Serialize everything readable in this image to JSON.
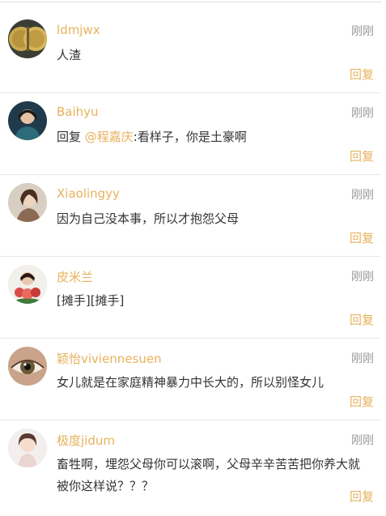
{
  "comments": [
    {
      "username": "ldmjwx",
      "time": "刚刚",
      "content": "人渣",
      "reply_label": "回复",
      "avatar_icon": "coins-avatar"
    },
    {
      "username": "Baihyu",
      "time": "刚刚",
      "content_prefix": "回复 ",
      "mention": "@程嘉庆",
      "content": ":看样子，你是土豪啊",
      "reply_label": "回复",
      "avatar_icon": "person-avatar"
    },
    {
      "username": "Xiaolingyy",
      "time": "刚刚",
      "content": "因为自己没本事，所以才抱怨父母",
      "reply_label": "回复",
      "avatar_icon": "girl-avatar"
    },
    {
      "username": "皮米兰",
      "time": "刚刚",
      "content": "[摊手][摊手]",
      "reply_label": "回复",
      "avatar_icon": "flowers-avatar"
    },
    {
      "username": "颖怡viviennesuen",
      "time": "刚刚",
      "content": "女儿就是在家庭精神暴力中长大的，所以别怪女儿",
      "reply_label": "回复",
      "avatar_icon": "eye-avatar"
    },
    {
      "username": "极度jidum",
      "time": "刚刚",
      "content": "畜牲啊，埋怨父母你可以滚啊，父母辛辛苦苦把你养大就被你这样说？？？",
      "reply_label": "回复",
      "avatar_icon": "woman-avatar"
    }
  ],
  "colors": {
    "accent": "#e7b25d",
    "text": "#333333",
    "muted": "#999999",
    "divider": "#e6e6e6"
  }
}
